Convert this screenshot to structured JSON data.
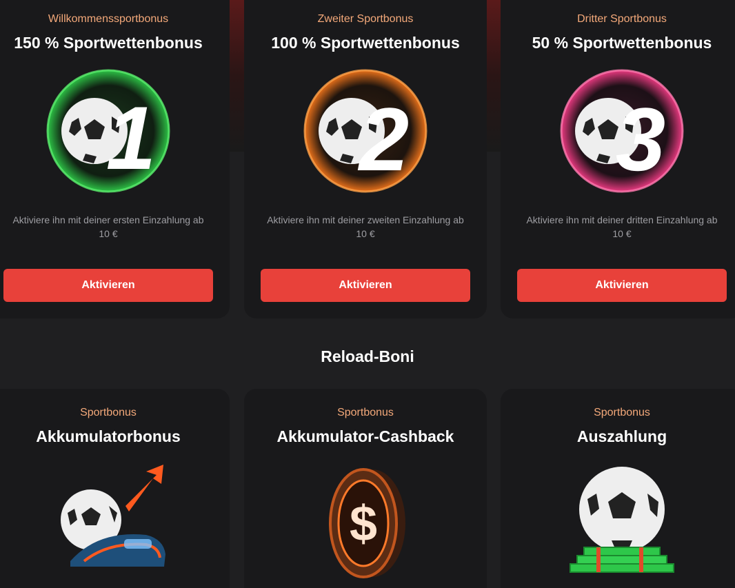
{
  "welcome": [
    {
      "kicker": "Willkommenssportbonus",
      "title": "150 % Sportwettenbonus",
      "number": "1",
      "accent": "#2fd44a",
      "desc_line1": "Aktiviere ihn mit deiner ersten Einzahlung ab",
      "desc_line2": "10 €",
      "button": "Aktivieren"
    },
    {
      "kicker": "Zweiter Sportbonus",
      "title": "100 % Sportwettenbonus",
      "number": "2",
      "accent": "#ff7a1a",
      "desc_line1": "Aktiviere ihn mit deiner zweiten Einzahlung ab",
      "desc_line2": "10 €",
      "button": "Aktivieren"
    },
    {
      "kicker": "Dritter Sportbonus",
      "title": "50 % Sportwettenbonus",
      "number": "3",
      "accent": "#ff3d8b",
      "desc_line1": "Aktiviere ihn mit deiner dritten Einzahlung ab",
      "desc_line2": "10 €",
      "button": "Aktivieren"
    }
  ],
  "reload_section_title": "Reload-Boni",
  "reload": [
    {
      "kicker": "Sportbonus",
      "title": "Akkumulatorbonus",
      "icon": "ball-train-arrow-icon"
    },
    {
      "kicker": "Sportbonus",
      "title": "Akkumulator-Cashback",
      "icon": "dollar-coin-icon"
    },
    {
      "kicker": "Sportbonus",
      "title": "Auszahlung",
      "icon": "ball-cash-stack-icon"
    }
  ],
  "colors": {
    "button": "#e8413a",
    "kicker": "#f4a97a",
    "card": "#19191b",
    "page": "#1f1f21"
  }
}
